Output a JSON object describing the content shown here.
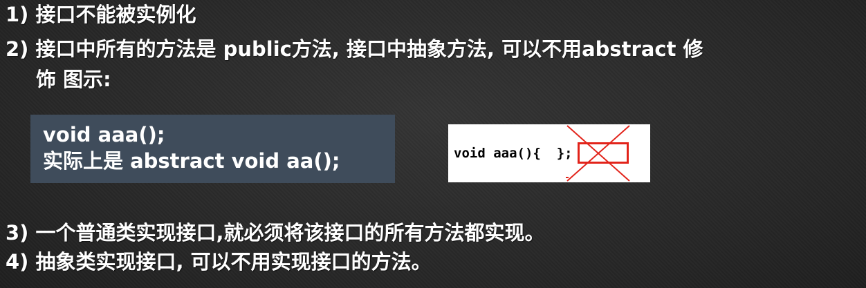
{
  "points": {
    "p1": "1) 接口不能被实例化",
    "p2_line1": "2) 接口中所有的方法是 public方法, 接口中抽象方法, 可以不用abstract 修",
    "p2_line2": "饰 图示:",
    "p3": "3) 一个普通类实现接口,就必须将该接口的所有方法都实现。",
    "p4": "4) 抽象类实现接口, 可以不用实现接口的方法。"
  },
  "code_block": {
    "line1": "void aaa();",
    "line2": "实际上是  abstract void aa();"
  },
  "illustration": {
    "code_text": "void aaa(){  };",
    "highlight_color": "#e2231a"
  }
}
